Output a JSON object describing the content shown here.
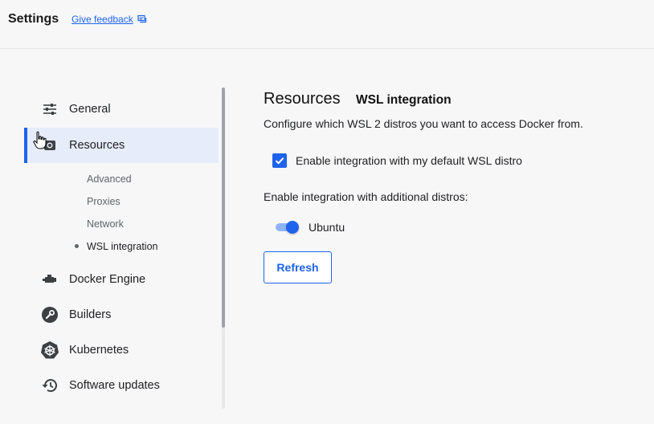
{
  "header": {
    "title": "Settings",
    "feedback_link": "Give feedback",
    "feedback_icon": "chat-bubble-icon"
  },
  "sidebar": {
    "items": [
      {
        "label": "General",
        "icon": "sliders-icon"
      },
      {
        "label": "Resources",
        "icon": "resources-icon",
        "active": true
      },
      {
        "label": "Docker Engine",
        "icon": "engine-icon"
      },
      {
        "label": "Builders",
        "icon": "wrench-icon"
      },
      {
        "label": "Kubernetes",
        "icon": "helm-wheel-icon"
      },
      {
        "label": "Software updates",
        "icon": "history-icon"
      }
    ],
    "subitems": [
      {
        "label": "Advanced"
      },
      {
        "label": "Proxies"
      },
      {
        "label": "Network"
      },
      {
        "label": "WSL integration",
        "current": true
      }
    ]
  },
  "main": {
    "title": "Resources",
    "subtitle": "WSL integration",
    "description": "Configure which WSL 2 distros you want to access Docker from.",
    "default_distro_checkbox": {
      "label": "Enable integration with my default WSL distro",
      "checked": true
    },
    "additional_label": "Enable integration with additional distros:",
    "distros": [
      {
        "label": "Ubuntu",
        "enabled": true
      }
    ],
    "refresh_button": "Refresh"
  },
  "colors": {
    "accent": "#1d63ed",
    "active_bg": "#e6ecfa",
    "background": "#f7f7f8"
  }
}
